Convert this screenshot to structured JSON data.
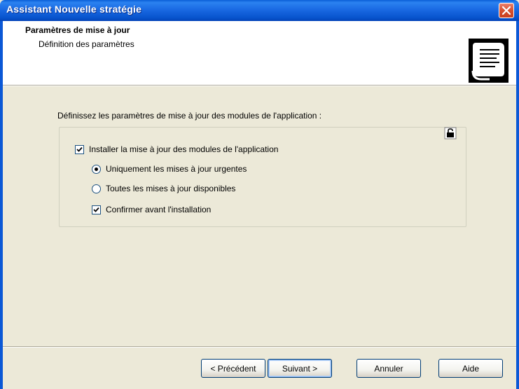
{
  "window": {
    "title": "Assistant Nouvelle stratégie"
  },
  "header": {
    "title": "Paramètres de mise à jour",
    "subtitle": "Définition des paramètres"
  },
  "content": {
    "intro": "Définissez les paramètres de mise à jour des modules de l'application :",
    "options": {
      "install_updates": {
        "label": "Installer la mise à jour des modules de l'application",
        "checked": true
      },
      "urgent_only": {
        "label": "Uniquement les mises à jour urgentes",
        "selected": true
      },
      "all_available": {
        "label": "Toutes les mises à jour disponibles",
        "selected": false
      },
      "confirm_before": {
        "label": "Confirmer avant l'installation",
        "checked": true
      }
    }
  },
  "buttons": {
    "previous": "< Précédent",
    "next": "Suivant >",
    "cancel": "Annuler",
    "help": "Aide"
  },
  "colors": {
    "titlebar": "#1a6ae3",
    "close": "#d6502f",
    "dialog_bg": "#ece9d8"
  }
}
